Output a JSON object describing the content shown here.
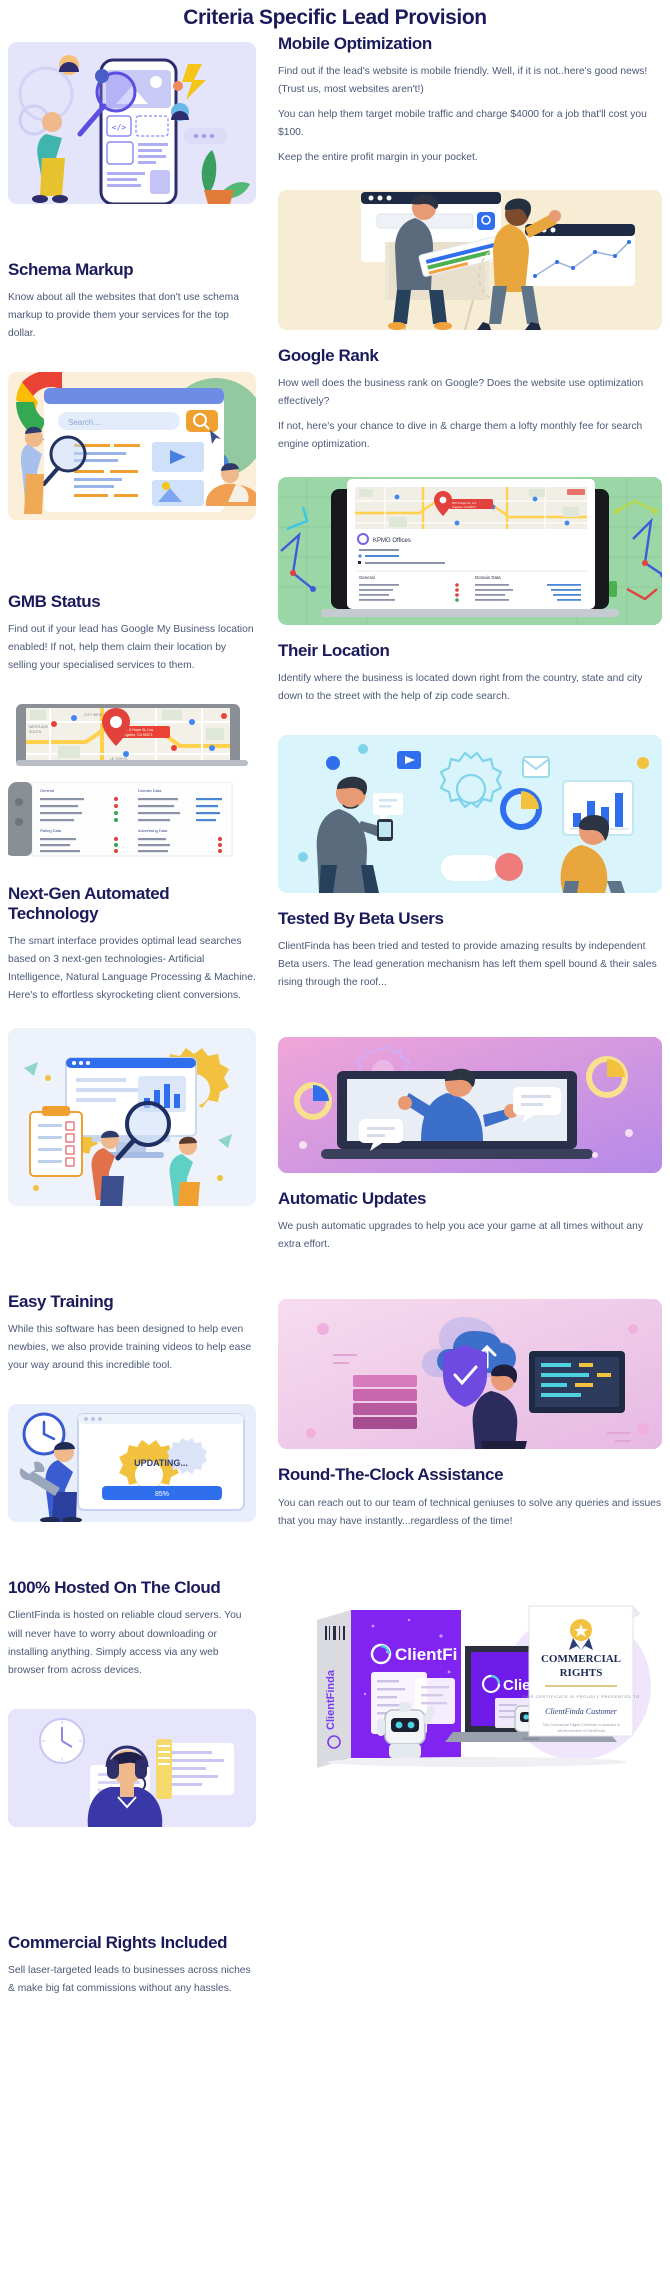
{
  "page": {
    "title": "Criteria Specific Lead Provision"
  },
  "colors": {
    "heading": "#1b1b5c",
    "body": "#4b5878",
    "accent_purple": "#7b5cf0",
    "accent_blue": "#2f6fed",
    "accent_orange": "#f2a13b",
    "accent_green": "#8fd39a",
    "accent_red": "#e2413c"
  },
  "sections": [
    {
      "id": "mobile-optimization",
      "side": "right",
      "heading": "Mobile Optimization",
      "paragraphs": [
        "Find out if the lead's website is mobile friendly. Well, if it is not..here's good news! (Trust us, most websites aren't!)",
        "You can help them target mobile traffic and charge $4000 for a job that'll cost you $100.",
        "Keep the entire profit margin in your pocket."
      ],
      "illustration": {
        "name": "mobile-optimization-illustration",
        "alt": "Woman inspecting a smartphone UI with a magnifying glass, avatars and plant",
        "background": "#e4e4fb"
      }
    },
    {
      "id": "schema-markup",
      "side": "left",
      "heading": "Schema Markup",
      "paragraphs": [
        "Know about all the websites that don't use schema markup to provide them your services for the top dollar."
      ],
      "illustration": {
        "name": "schema-markup-illustration",
        "alt": "Google search page with magnifying glass, globe and people",
        "background": "#fbefd9"
      }
    },
    {
      "id": "google-rank",
      "side": "right",
      "heading": "Google Rank",
      "paragraphs": [
        "How well does the business rank on Google? Does the website use optimization effectively?",
        "If not, here's your chance to dive in & charge them a lofty monthly fee for search engine optimization."
      ],
      "illustration": {
        "name": "google-rank-illustration",
        "alt": "Two people with browser windows, search bar and analytics chart",
        "background": "#f7edd5"
      }
    },
    {
      "id": "gmb-status",
      "side": "left",
      "heading": "GMB Status",
      "paragraphs": [
        "Find out if your lead has Google My Business location enabled! If not, help them claim their location by selling your specialised services to them."
      ],
      "illustration": {
        "name": "gmb-map-illustration",
        "alt": "Tablet showing a city map with a red location pin",
        "background": "#ffffff"
      }
    },
    {
      "id": "their-location",
      "side": "right",
      "heading": "Their Location",
      "paragraphs": [
        "Identify where the business is located down right from the country, state and city down to the street with the help of zip code search."
      ],
      "illustration": {
        "name": "location-dashboard-illustration",
        "alt": "Laptop showing a lead report dashboard with map and data tables on green background",
        "background": "#9bd6a6"
      }
    },
    {
      "id": "next-gen-automated-technology",
      "side": "left",
      "heading": "Next-Gen Automated Technology",
      "paragraphs": [
        "The smart interface provides optimal lead searches based on 3 next-gen technologies- Artificial Intelligence, Natural Language Processing & Machine. Here's to effortless skyrocketing client conversions."
      ],
      "illustration": {
        "name": "automation-gears-illustration",
        "alt": "Person with large gears, desktop monitor and magnifying glass",
        "background": "#eef3fb"
      }
    },
    {
      "id": "tested-by-beta-users",
      "side": "right",
      "heading": "Tested By Beta Users",
      "paragraphs": [
        "ClientFinda has been tried and tested to provide amazing results by independent Beta users. The lead generation mechanism has left them spell bound & their sales rising through the roof..."
      ],
      "illustration": {
        "name": "beta-users-illustration",
        "alt": "Two people with charts, gears and mail icons on light blue background",
        "background": "#d9f4fb"
      }
    },
    {
      "id": "easy-training",
      "side": "left",
      "heading": "Easy Training",
      "paragraphs": [
        "While this software has been designed to help even newbies, we also provide training videos to help ease your way around this incredible tool."
      ],
      "illustration": {
        "name": "training-checklist-illustration",
        "alt": "People beside a monitor with a testing checklist clipboard",
        "background": "#eef2fa"
      }
    },
    {
      "id": "automatic-updates",
      "side": "right",
      "heading": "Automatic Updates",
      "paragraphs": [
        "We push automatic upgrades to help you ace your game at all times without any extra effort."
      ],
      "illustration": {
        "name": "video-training-illustration",
        "alt": "Man presenting on a laptop screen with chat bubbles and gears on pink gradient",
        "background": "#e8b7e2"
      }
    },
    {
      "id": "hosted-on-the-cloud",
      "side": "left",
      "heading": "100% Hosted On The Cloud",
      "paragraphs": [
        "ClientFinda is hosted on reliable cloud servers. You will never have to worry about downloading or installing anything. Simply access via any web browser from across devices."
      ],
      "illustration": {
        "name": "updating-progress-illustration",
        "alt": "Man with wrench beside a browser window showing UPDATING... and 85% progress",
        "background": "#e9eefb"
      }
    },
    {
      "id": "round-the-clock-assistance",
      "side": "right",
      "heading": "Round-The-Clock Assistance",
      "paragraphs": [
        "You can reach out to our team of technical geniuses to solve any queries and issues that you may have instantly...regardless of the time!"
      ],
      "illustration": {
        "name": "cloud-hosting-illustration",
        "alt": "Person with shield, cloud upload icon and servers on pink gradient",
        "background": "#f2cfe6"
      }
    },
    {
      "id": "commercial-rights-included",
      "side": "left",
      "heading": "Commercial Rights Included",
      "paragraphs": [
        "Sell laser-targeted leads to businesses across niches & make big fat commissions without any hassles."
      ],
      "illustration": {
        "name": "support-agent-illustration",
        "alt": "Support agent wearing a headset with document panels",
        "background": "#e7e5fb"
      }
    },
    {
      "id": "commercial-rights-product",
      "side": "right",
      "heading": "",
      "paragraphs": [],
      "illustration": {
        "name": "clientfinda-product-box-illustration",
        "alt": "ClientFinda product box, laptop mockup and Commercial Rights certificate",
        "background": "#ffffff"
      }
    }
  ],
  "illustration_labels": {
    "search_placeholder": "Search....",
    "gmb_business_name": "KPMG Offices",
    "report_general": "General",
    "report_domain": "Domain Data",
    "report_rating": "Rating Data",
    "report_advertising": "Advertising Data",
    "updating_text": "UPDATING...",
    "updating_percent": "85%",
    "code_icon": "</>",
    "product_brand": "ClientFinda",
    "certificate_title": "COMMERCIAL RIGHTS",
    "certificate_presented": "THIS CERTIFICATE IS PROUDLY PRESENTED TO",
    "certificate_name": "ClientFinda Customer",
    "certificate_note": "This Commercial Rights Certificate is awarded to official member of ClientFinda"
  }
}
